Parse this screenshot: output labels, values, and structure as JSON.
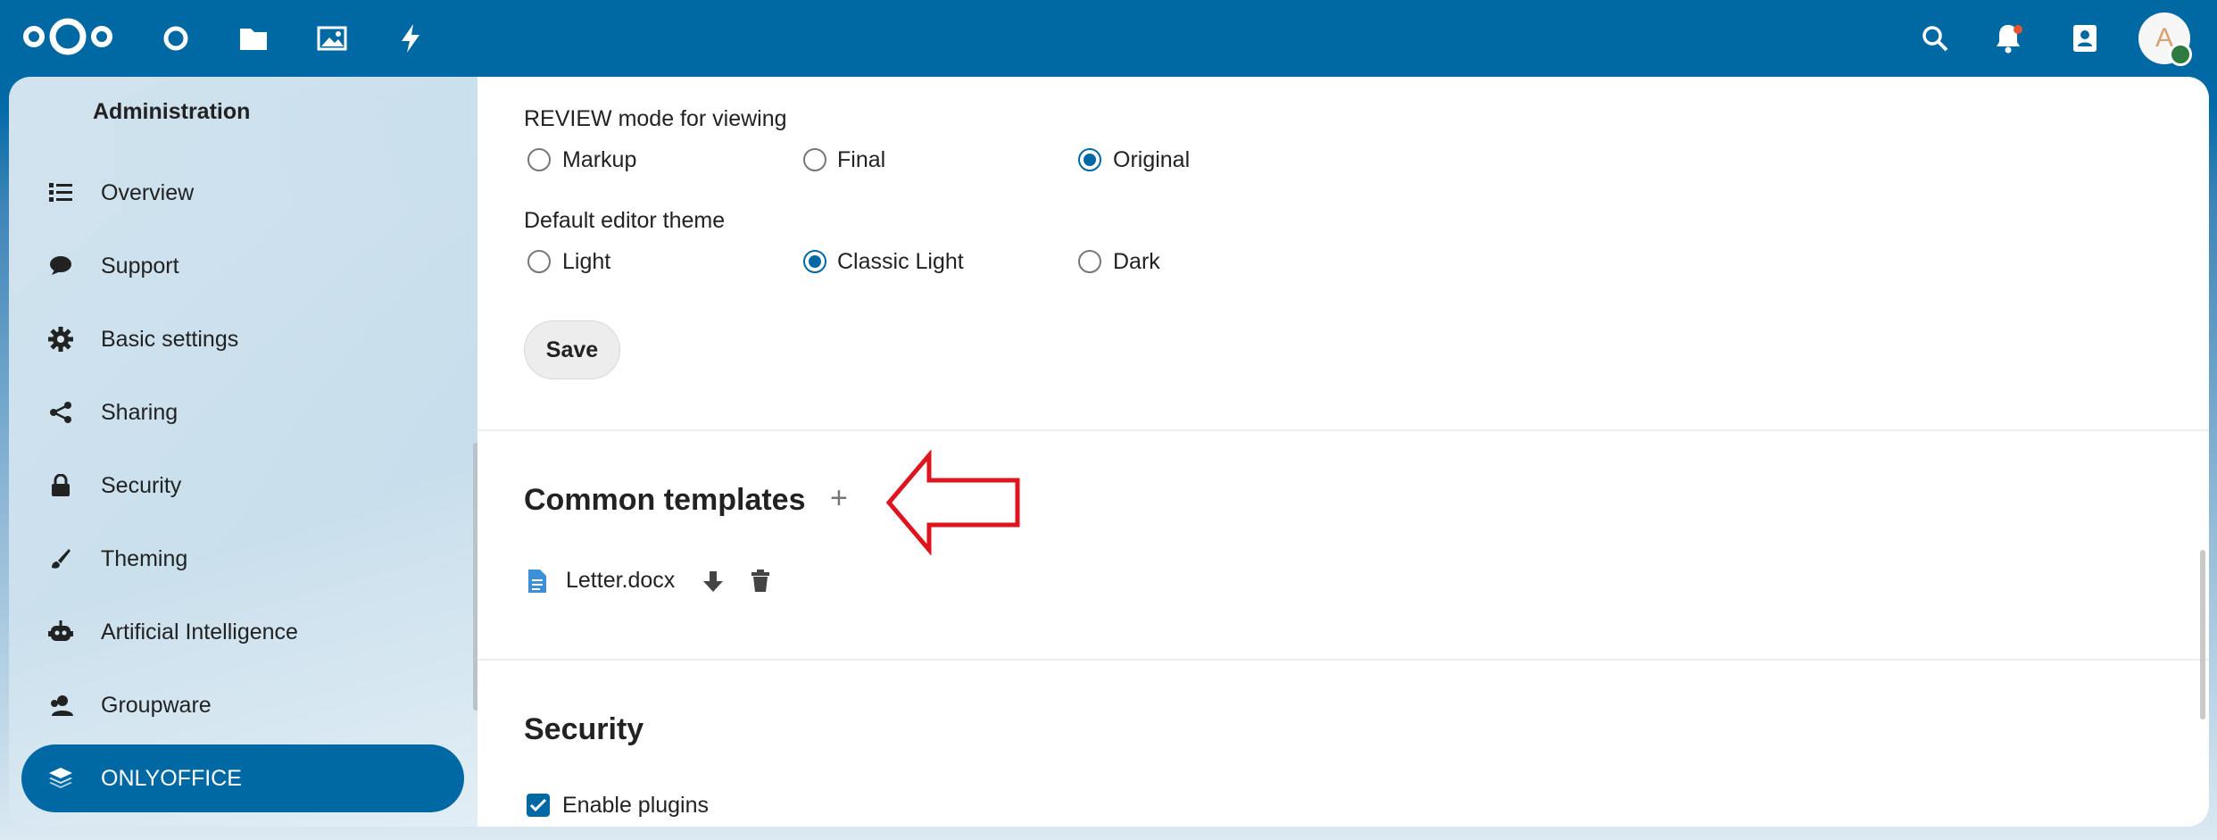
{
  "header": {
    "icons": [
      "nextcloud-logo-icon",
      "dashboard-icon",
      "files-icon",
      "photos-icon",
      "activity-icon",
      "search-icon",
      "notifications-icon",
      "contacts-icon"
    ],
    "avatar_letter": "A"
  },
  "sidebar": {
    "title": "Administration",
    "items": [
      {
        "label": "Overview",
        "icon": "list-icon"
      },
      {
        "label": "Support",
        "icon": "chat-bubble-icon"
      },
      {
        "label": "Basic settings",
        "icon": "gear-icon"
      },
      {
        "label": "Sharing",
        "icon": "share-icon"
      },
      {
        "label": "Security",
        "icon": "lock-icon"
      },
      {
        "label": "Theming",
        "icon": "paintbrush-icon"
      },
      {
        "label": "Artificial Intelligence",
        "icon": "robot-icon"
      },
      {
        "label": "Groupware",
        "icon": "user-group-icon"
      },
      {
        "label": "ONLYOFFICE",
        "icon": "onlyoffice-layers-icon",
        "active": true
      }
    ]
  },
  "main": {
    "review_mode": {
      "label": "REVIEW mode for viewing",
      "options": [
        "Markup",
        "Final",
        "Original"
      ],
      "selected": "Original"
    },
    "editor_theme": {
      "label": "Default editor theme",
      "options": [
        "Light",
        "Classic Light",
        "Dark"
      ],
      "selected": "Classic Light"
    },
    "save_label": "Save",
    "common_templates": {
      "heading": "Common templates",
      "add_symbol": "+",
      "files": [
        {
          "name": "Letter.docx"
        }
      ]
    },
    "security": {
      "heading": "Security",
      "enable_plugins_label": "Enable plugins",
      "enable_plugins_checked": true
    }
  },
  "colors": {
    "brand": "#0068a3",
    "annotation_arrow": "#e0141e"
  }
}
